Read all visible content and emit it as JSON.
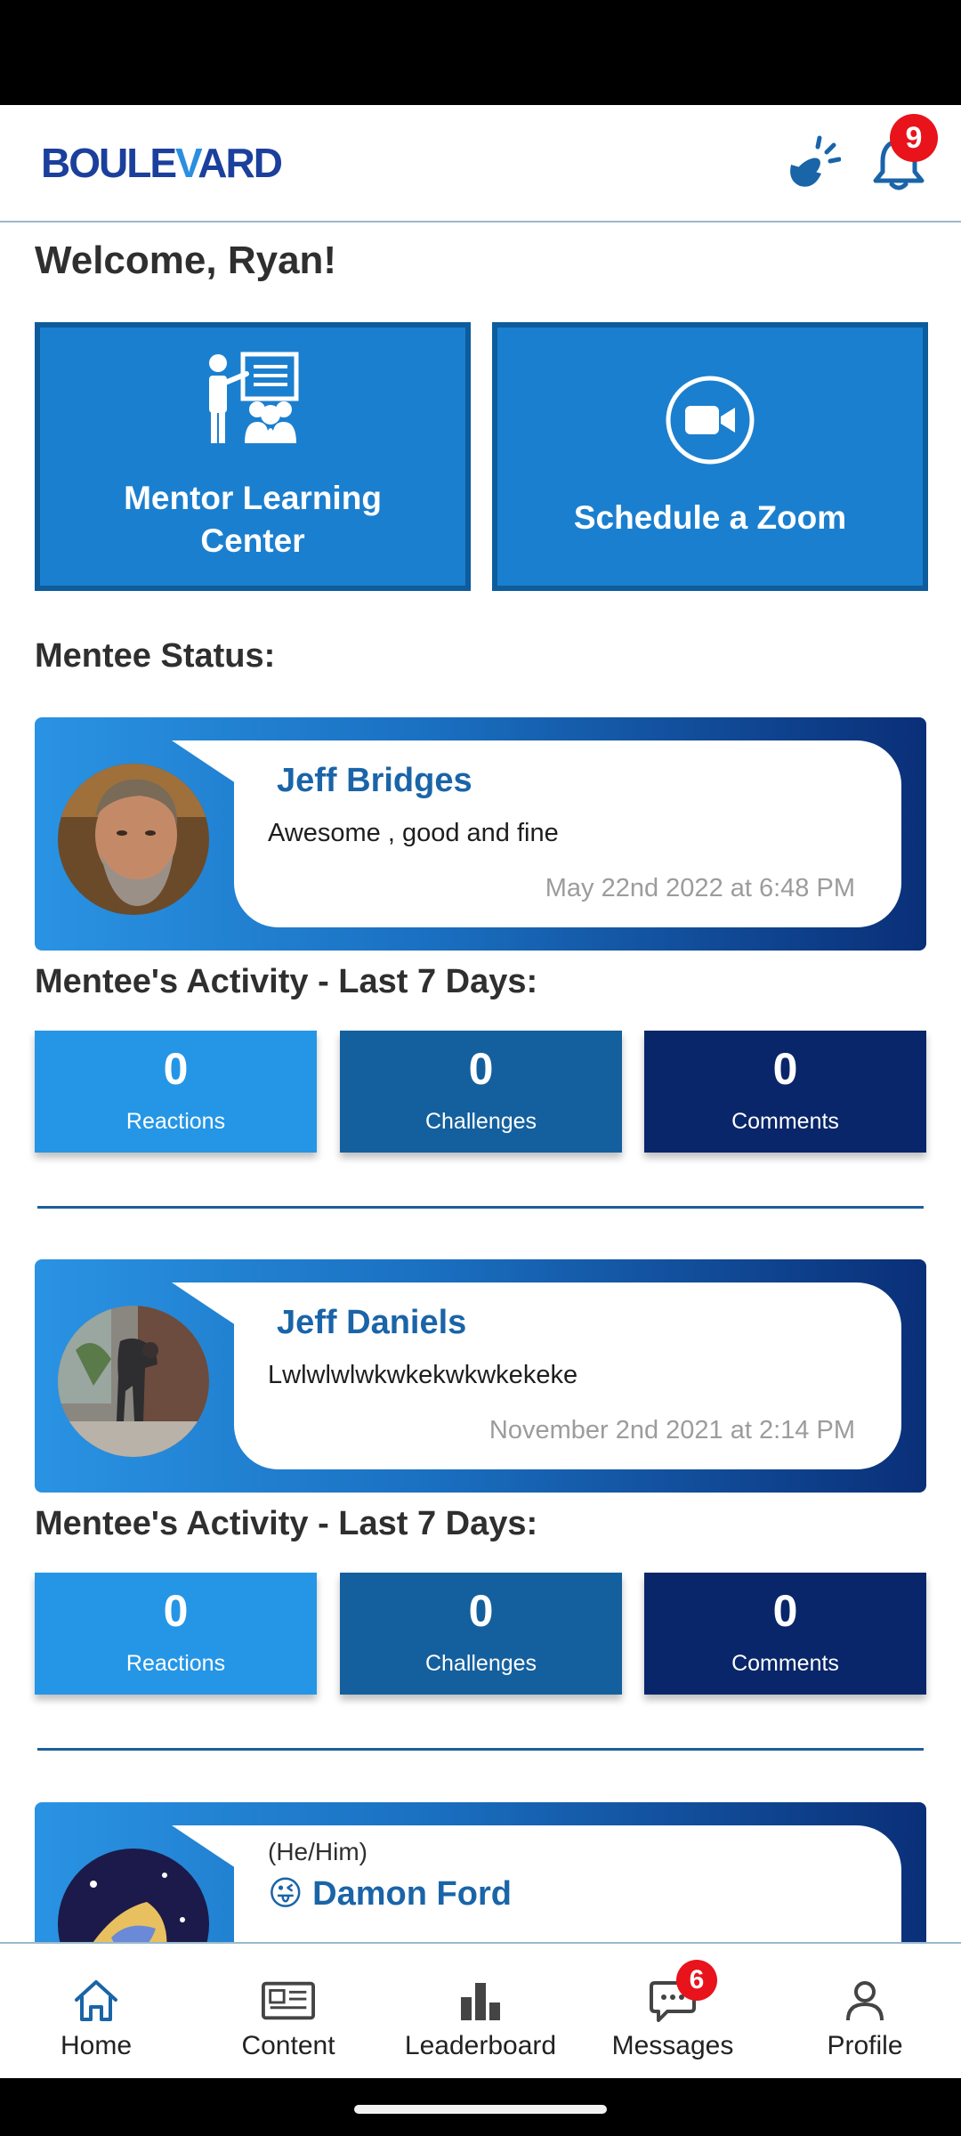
{
  "header": {
    "logo_text_a": "BOULE",
    "logo_text_b": "V",
    "logo_text_c": "ARD",
    "notification_count": "9"
  },
  "welcome": "Welcome, Ryan!",
  "tiles": {
    "learning_label": "Mentor Learning Center",
    "zoom_label": "Schedule a Zoom"
  },
  "mentee_status_title": "Mentee Status:",
  "activity_title": "Mentee's Activity - Last 7 Days:",
  "stat_labels": {
    "reactions": "Reactions",
    "challenges": "Challenges",
    "comments": "Comments"
  },
  "mentees": [
    {
      "name": "Jeff Bridges",
      "status": "Awesome , good and fine",
      "date": "May 22nd 2022 at 6:48 PM",
      "reactions": "0",
      "challenges": "0",
      "comments": "0"
    },
    {
      "name": "Jeff Daniels",
      "status": "Lwlwlwlwkwkekwkwkekeke",
      "date": "November 2nd 2021 at 2:14 PM",
      "reactions": "0",
      "challenges": "0",
      "comments": "0"
    },
    {
      "pronoun": "(He/Him)",
      "name": "😜 Damon Ford"
    }
  ],
  "bottom_nav": {
    "home": "Home",
    "content": "Content",
    "leaderboard": "Leaderboard",
    "messages": "Messages",
    "messages_badge": "6",
    "profile": "Profile"
  },
  "colors": {
    "primary": "#1b7fcf",
    "brand_dark": "#1b3f9c",
    "badge_red": "#e8131b",
    "reactions_bg": "#2596e6",
    "challenges_bg": "#14609e",
    "comments_bg": "#09266a"
  }
}
